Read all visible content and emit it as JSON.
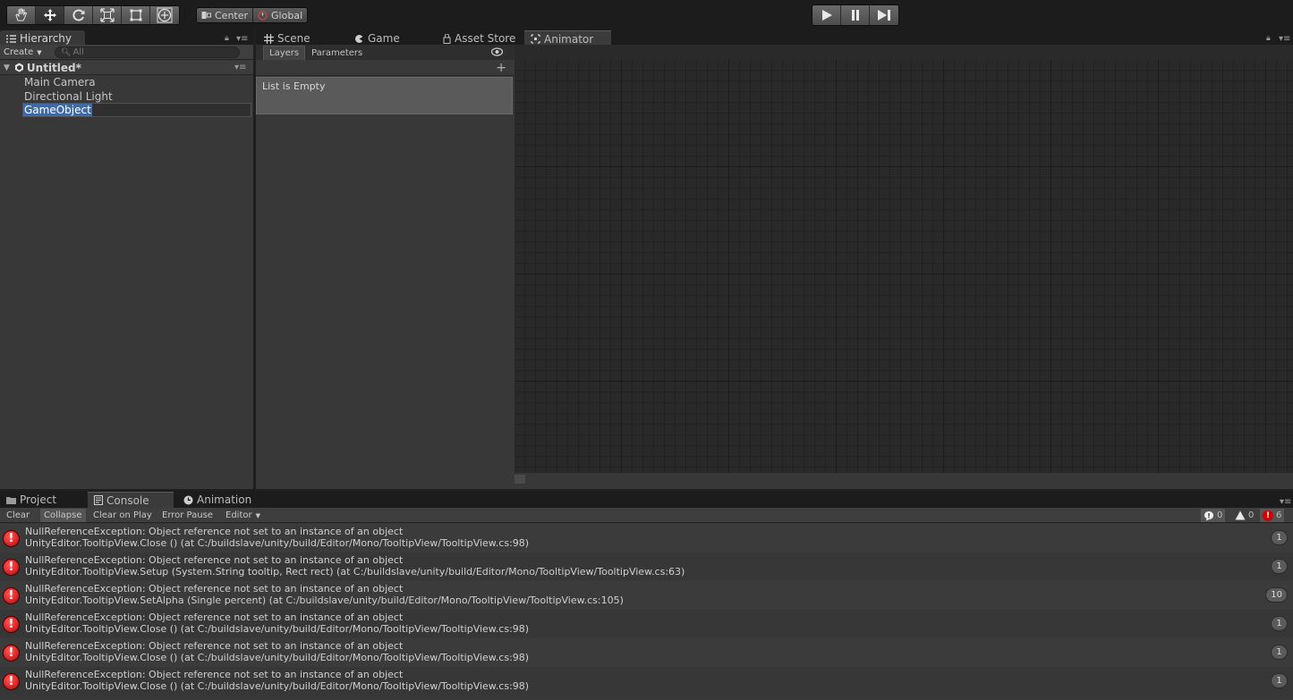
{
  "toolbar": {
    "tools": [
      {
        "name": "hand-tool",
        "icon": "hand-icon"
      },
      {
        "name": "move-tool",
        "icon": "move-icon"
      },
      {
        "name": "rotate-tool",
        "icon": "rotate-icon"
      },
      {
        "name": "scale-tool",
        "icon": "scale-icon"
      },
      {
        "name": "rect-tool",
        "icon": "rect-icon"
      },
      {
        "name": "transform-tool",
        "icon": "transform-icon"
      }
    ],
    "pivot_label": "Center",
    "rotation_label": "Global"
  },
  "hierarchy": {
    "tab_label": "Hierarchy",
    "create_label": "Create",
    "search_placeholder": "All",
    "scene_name": "Untitled*",
    "items": [
      "Main Camera",
      "Directional Light",
      "GameObject"
    ],
    "selected_index": 2
  },
  "center_tabs": {
    "scene": "Scene",
    "game": "Game",
    "asset_store": "Asset Store",
    "animator": "Animator"
  },
  "animator": {
    "subtabs": {
      "layers": "Layers",
      "parameters": "Parameters"
    },
    "empty_text": "List is Empty"
  },
  "bottom_tabs": {
    "project": "Project",
    "console": "Console",
    "animation": "Animation"
  },
  "console": {
    "buttons": {
      "clear": "Clear",
      "collapse": "Collapse",
      "clear_on_play": "Clear on Play",
      "error_pause": "Error Pause",
      "editor": "Editor"
    },
    "counts": {
      "info": "0",
      "warning": "0",
      "error": "6"
    },
    "entries": [
      {
        "line1": "NullReferenceException: Object reference not set to an instance of an object",
        "line2": "UnityEditor.TooltipView.Close () (at C:/buildslave/unity/build/Editor/Mono/TooltipView/TooltipView.cs:98)",
        "count": "1"
      },
      {
        "line1": "NullReferenceException: Object reference not set to an instance of an object",
        "line2": "UnityEditor.TooltipView.Setup (System.String tooltip, Rect rect) (at C:/buildslave/unity/build/Editor/Mono/TooltipView/TooltipView.cs:63)",
        "count": "1"
      },
      {
        "line1": "NullReferenceException: Object reference not set to an instance of an object",
        "line2": "UnityEditor.TooltipView.SetAlpha (Single percent) (at C:/buildslave/unity/build/Editor/Mono/TooltipView/TooltipView.cs:105)",
        "count": "10"
      },
      {
        "line1": "NullReferenceException: Object reference not set to an instance of an object",
        "line2": "UnityEditor.TooltipView.Close () (at C:/buildslave/unity/build/Editor/Mono/TooltipView/TooltipView.cs:98)",
        "count": "1"
      },
      {
        "line1": "NullReferenceException: Object reference not set to an instance of an object",
        "line2": "UnityEditor.TooltipView.Close () (at C:/buildslave/unity/build/Editor/Mono/TooltipView/TooltipView.cs:98)",
        "count": "1"
      },
      {
        "line1": "NullReferenceException: Object reference not set to an instance of an object",
        "line2": "UnityEditor.TooltipView.Close () (at C:/buildslave/unity/build/Editor/Mono/TooltipView/TooltipView.cs:98)",
        "count": "1"
      }
    ]
  },
  "colors": {
    "error_red": "#d40000",
    "selection_blue": "#3e6ba8",
    "panel_bg": "#383838"
  }
}
